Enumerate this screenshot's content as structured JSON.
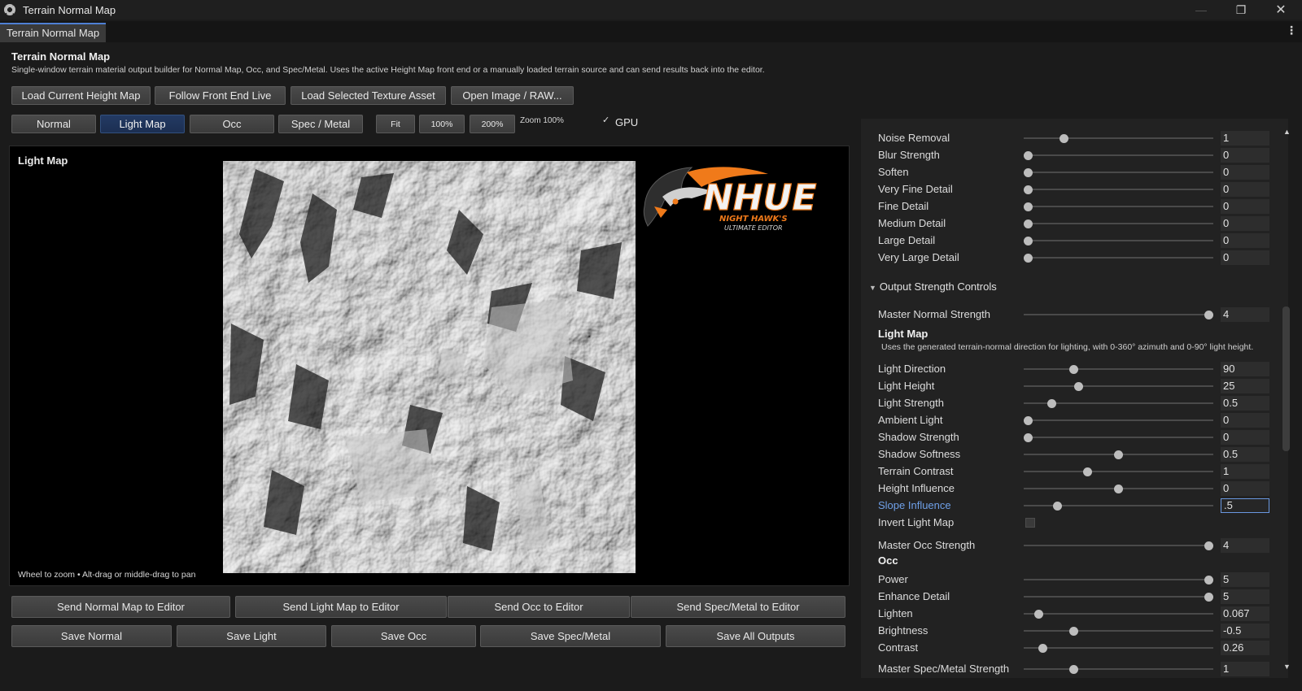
{
  "window": {
    "title": "Terrain Normal Map",
    "tab": "Terrain Normal Map"
  },
  "header": {
    "title": "Terrain Normal Map",
    "subtitle": "Single-window terrain material output builder for Normal Map, Occ, and Spec/Metal. Uses the active Height Map front end or a manually loaded terrain source and can send results back into the editor."
  },
  "source_buttons": [
    "Load Current Height Map",
    "Follow Front End Live",
    "Load Selected Texture Asset",
    "Open Image / RAW..."
  ],
  "view_tabs": [
    {
      "label": "Normal",
      "active": false
    },
    {
      "label": "Light Map",
      "active": true
    },
    {
      "label": "Occ",
      "active": false
    },
    {
      "label": "Spec / Metal",
      "active": false
    }
  ],
  "zoom_buttons": [
    "Fit",
    "100%",
    "200%"
  ],
  "zoom_label": "Zoom 100%",
  "gpu": {
    "label": "GPU",
    "checked": true,
    "check_glyph": "✓"
  },
  "viewport": {
    "label": "Light Map",
    "hint": "Wheel to zoom • Alt-drag or middle-drag to pan"
  },
  "logo": {
    "brand": "NHUE",
    "line1": "NIGHT HAWK'S",
    "line2": "ULTIMATE EDITOR",
    "accent": "#f07a1a"
  },
  "send_buttons": [
    "Send Normal Map to Editor",
    "Send Light Map to Editor",
    "Send Occ to Editor",
    "Send Spec/Metal to Editor"
  ],
  "save_buttons": [
    "Save Normal",
    "Save Light",
    "Save Occ",
    "Save Spec/Metal",
    "Save All Outputs"
  ],
  "panel": {
    "detail_rows": [
      {
        "label": "Noise Removal",
        "value": "1",
        "level": 0.2
      },
      {
        "label": "Blur Strength",
        "value": "0",
        "level": 0
      },
      {
        "label": "Soften",
        "value": "0",
        "level": 0
      },
      {
        "label": "Very Fine Detail",
        "value": "0",
        "level": 0
      },
      {
        "label": "Fine Detail",
        "value": "0",
        "level": 0
      },
      {
        "label": "Medium Detail",
        "value": "0",
        "level": 0
      },
      {
        "label": "Large Detail",
        "value": "0",
        "level": 0
      },
      {
        "label": "Very Large Detail",
        "value": "0",
        "level": 0
      }
    ],
    "output_section": "Output Strength Controls",
    "master_normal": {
      "label": "Master Normal Strength",
      "value": "4",
      "level": 1
    },
    "light_map": {
      "heading": "Light Map",
      "desc": "Uses the generated terrain-normal direction for lighting, with 0-360° azimuth and 0-90° light height.",
      "rows": [
        {
          "label": "Light Direction",
          "value": "90",
          "level": 0.25
        },
        {
          "label": "Light Height",
          "value": "25",
          "level": 0.28
        },
        {
          "label": "Light Strength",
          "value": "0.5",
          "level": 0.13
        },
        {
          "label": "Ambient Light",
          "value": "0",
          "level": 0
        },
        {
          "label": "Shadow Strength",
          "value": "0",
          "level": 0
        },
        {
          "label": "Shadow Softness",
          "value": "0.5",
          "level": 0.5
        },
        {
          "label": "Terrain Contrast",
          "value": "1",
          "level": 0.33
        },
        {
          "label": "Height Influence",
          "value": "0",
          "level": 0.5
        },
        {
          "label": "Slope Influence",
          "value": ".5",
          "level": 0.16,
          "focused": true
        }
      ],
      "invert": {
        "label": "Invert Light Map",
        "checked": false
      }
    },
    "master_occ": {
      "label": "Master Occ Strength",
      "value": "4",
      "level": 1
    },
    "occ": {
      "heading": "Occ",
      "rows": [
        {
          "label": "Power",
          "value": "5",
          "level": 1
        },
        {
          "label": "Enhance Detail",
          "value": "5",
          "level": 1
        },
        {
          "label": "Lighten",
          "value": "0.067",
          "level": 0.06
        },
        {
          "label": "Brightness",
          "value": "-0.5",
          "level": 0.25
        },
        {
          "label": "Contrast",
          "value": "0.26",
          "level": 0.08
        }
      ]
    },
    "master_spec": {
      "label": "Master Spec/Metal Strength",
      "value": "1",
      "level": 0.25
    }
  }
}
